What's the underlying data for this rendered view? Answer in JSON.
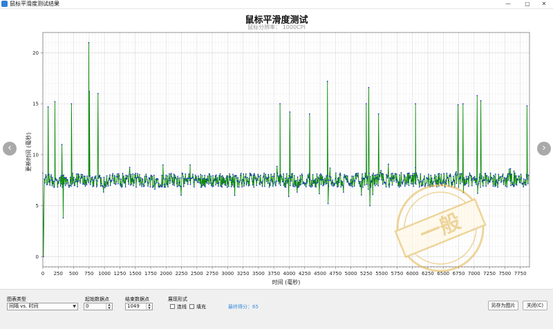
{
  "window": {
    "title": "鼠标平滑度测试结果",
    "controls": {
      "minimize": "—",
      "maximize": "▢",
      "close": "✕"
    }
  },
  "chart": {
    "title": "鼠标平滑度测试",
    "subtitle": "鼠标分辨率： 1000CPI",
    "xlabel": "时间 (毫秒)",
    "ylabel": "更新时间 (毫秒)",
    "colors": {
      "line": "#0a8a0a",
      "point": "#1c3fb0",
      "grid_major": "#dcdcdc",
      "grid_minor": "#efefef",
      "axis": "#7a7a7a"
    }
  },
  "chart_data": {
    "type": "line",
    "title": "鼠标平滑度测试",
    "subtitle": "鼠标分辨率： 1000CPI",
    "xlabel": "时间 (毫秒)",
    "ylabel": "更新时间 (毫秒)",
    "xlim": [
      0,
      7900
    ],
    "ylim": [
      -1,
      22
    ],
    "xticks": [
      0,
      250,
      500,
      750,
      1000,
      1250,
      1500,
      1750,
      2000,
      2250,
      2500,
      2750,
      3000,
      3250,
      3500,
      3750,
      4000,
      4250,
      4500,
      4750,
      5000,
      5250,
      5500,
      5750,
      6000,
      6250,
      6500,
      6750,
      7000,
      7250,
      7500,
      7750
    ],
    "yticks": [
      0,
      5,
      10,
      15,
      20
    ],
    "grid": true,
    "series": [
      {
        "baseline": 7.5,
        "noise_range": [
          6.8,
          8.2
        ],
        "samples": 1049,
        "start": [
          [
            0,
            8.2
          ],
          [
            10,
            0
          ],
          [
            25,
            7.6
          ]
        ],
        "spikes": [
          [
            85,
            14.7
          ],
          [
            195,
            15.2
          ],
          [
            310,
            11.0
          ],
          [
            330,
            3.8
          ],
          [
            465,
            15.0
          ],
          [
            745,
            21.0
          ],
          [
            755,
            16.2
          ],
          [
            895,
            16.0
          ],
          [
            1950,
            9.0
          ],
          [
            2390,
            9.0
          ],
          [
            3850,
            15.0
          ],
          [
            3990,
            5.9
          ],
          [
            4010,
            14.2
          ],
          [
            4330,
            14.0
          ],
          [
            4620,
            17.2
          ],
          [
            4630,
            5.2
          ],
          [
            5250,
            15.0
          ],
          [
            5290,
            16.6
          ],
          [
            5310,
            5.0
          ],
          [
            5450,
            14.0
          ],
          [
            6050,
            15.0
          ],
          [
            6740,
            14.9
          ],
          [
            6820,
            15.0
          ],
          [
            7050,
            15.8
          ],
          [
            7110,
            15.3
          ],
          [
            7860,
            14.8
          ]
        ]
      }
    ]
  },
  "nav": {
    "prev": "‹",
    "next": "›"
  },
  "stamp": {
    "text": "一般"
  },
  "controls": {
    "chart_type_label": "图表类型",
    "chart_type_value": "间隔 vs. 时间",
    "start_label": "起始数据点",
    "start_value": "0",
    "end_label": "结束数据点",
    "end_value": "1049",
    "display_label": "展现形式",
    "line_label": "连线",
    "fill_label": "填充",
    "score_text": "最终得分：65",
    "save_label": "另存为图片",
    "close_label": "关闭(C)"
  }
}
